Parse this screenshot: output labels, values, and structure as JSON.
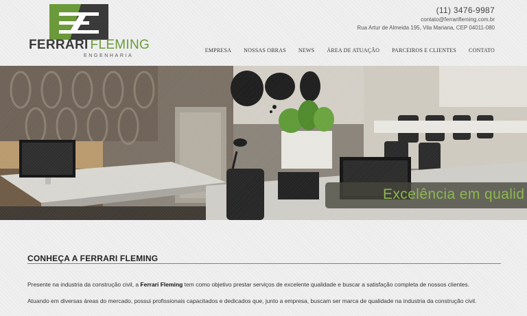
{
  "brand": {
    "name_part1": "FERRARI",
    "name_part2": "FLEMING",
    "subtitle": "ENGENHARIA",
    "colors": {
      "green": "#6b9a3a",
      "dark": "#3a3a3a"
    }
  },
  "contact": {
    "phone": "(11) 3476-9987",
    "email": "contato@ferrarifleming.com.br",
    "address": "Rua Artur de Almeida 195, Vila Mariana, CEP 04011-080"
  },
  "nav": {
    "items": [
      {
        "label": "EMPRESA"
      },
      {
        "label": "NOSSAS OBRAS"
      },
      {
        "label": "NEWS"
      },
      {
        "label": "ÁREA DE ATUAÇÃO"
      },
      {
        "label": "PARCEIROS E CLIENTES"
      },
      {
        "label": "CONTATO"
      }
    ]
  },
  "hero": {
    "slogan": "Excelência em qualid"
  },
  "about": {
    "title": "CONHEÇA A FERRARI FLEMING",
    "p1_before": "Presente na industria da construção civil, a ",
    "p1_bold": "Ferrari Fleming",
    "p1_after": " tem como objetivo prestar serviços de excelente qualidade e buscar a satisfação completa de nossos clientes.",
    "p2": "Atuando em diversas áreas do mercado, possui profissionais capacitados e dedicados que, junto a empresa, buscam ser marca de qualidade na industria da construção civil."
  }
}
